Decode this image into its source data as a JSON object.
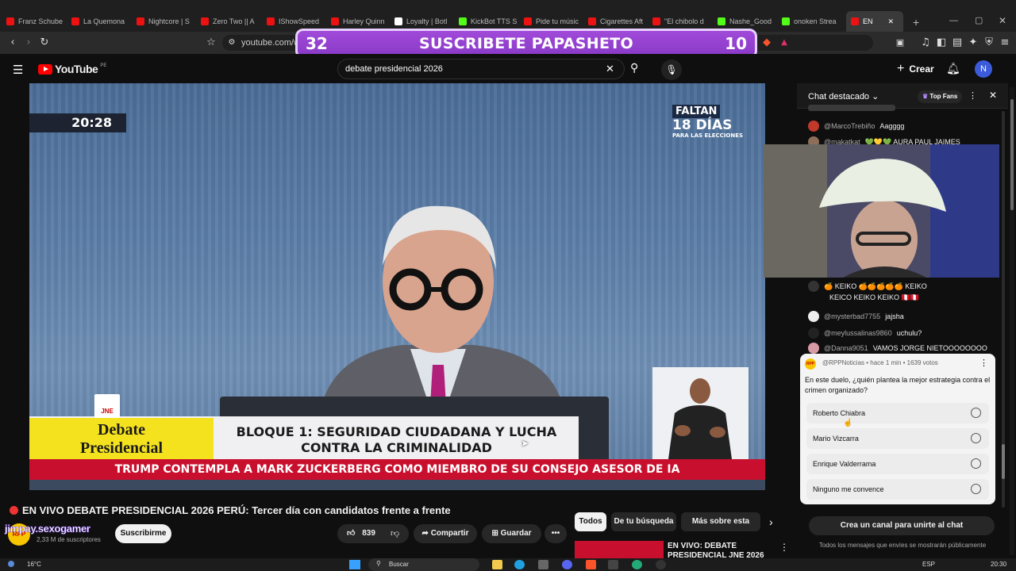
{
  "browser": {
    "tabs": [
      {
        "label": "Franz Schube",
        "kind": "yt"
      },
      {
        "label": "La Quemona",
        "kind": "yt"
      },
      {
        "label": "Nightcore | S",
        "kind": "yt"
      },
      {
        "label": "Zero Two || A",
        "kind": "yt"
      },
      {
        "label": "IShowSpeed",
        "kind": "yt"
      },
      {
        "label": "Harley Quinn",
        "kind": "yt"
      },
      {
        "label": "Loyalty | Botl",
        "kind": "other"
      },
      {
        "label": "KickBot TTS S",
        "kind": "k"
      },
      {
        "label": "Pide tu músic",
        "kind": "yt"
      },
      {
        "label": "Cigarettes Aft",
        "kind": "yt"
      },
      {
        "label": "\"El chibolo d",
        "kind": "yt"
      },
      {
        "label": "Nashe_Good",
        "kind": "k"
      },
      {
        "label": "onoken Strea",
        "kind": "k"
      },
      {
        "label": "EN",
        "kind": "yt",
        "active": true
      }
    ],
    "url": "youtube.com/w"
  },
  "banner": {
    "left_number": "32",
    "text": "SUSCRIBETE PAPASHETO",
    "right_number": "10"
  },
  "youtube": {
    "logo": "YouTube",
    "region": "PE",
    "search_value": "debate presidencial 2026",
    "create_label": "Crear",
    "avatar_letter": "N"
  },
  "video": {
    "time_overlay": "20:28",
    "faltan_line1": "FALTAN",
    "faltan_line2": "18 DÍAS",
    "faltan_line3": "PARA LAS ELECCIONES",
    "jne_label": "JNE",
    "debate_label_line1": "Debate",
    "debate_label_line2": "Presidencial",
    "bloque_line1": "BLOQUE 1: SEGURIDAD CIUDADANA Y LUCHA",
    "bloque_line2": "CONTRA LA CRIMINALIDAD",
    "ticker": "TRUMP CONTEMPLA A MARK ZUCKERBERG COMO MIEMBRO DE SU CONSEJO ASESOR DE IA"
  },
  "below_video": {
    "title": "EN VIVO DEBATE PRESIDENCIAL 2026 PERÚ: Tercer día con candidatos frente a frente",
    "channel_overlay": "jimpay.sexogamer",
    "channel_logo": "RPP",
    "subscribers": "2,33 M de suscriptores",
    "subscribe_label": "Suscribirme",
    "likes": "839",
    "share_label": "Compartir",
    "save_label": "Guardar"
  },
  "filters": [
    "Todos",
    "De tu búsqueda",
    "Más sobre esta histor"
  ],
  "related_video_title": "EN VIVO: DEBATE PRESIDENCIAL JNE 2026",
  "chat": {
    "header_label": "Chat destacado",
    "top_fans_label": "Top Fans",
    "messages": [
      {
        "author": "@MarcoTrebiño",
        "text": "Aagggg",
        "color": "#c0392b"
      },
      {
        "author": "@makatkat",
        "text": "💚💛💚 AURA PAUL JAIMES",
        "color": "#8e6e5a"
      },
      {
        "author": "",
        "text": "🍊 KEIKO 🍊🍊🍊🍊🍊 KEIKO",
        "color": "#333333"
      },
      {
        "author": "",
        "text": "KEICO KEIKO KEIKO 🇵🇪🇵🇪",
        "color": "#333333"
      },
      {
        "author": "@mysterbad7755",
        "text": "jajsha",
        "color": "#eeeeee"
      },
      {
        "author": "@meylussalinas9860",
        "text": "uchulu?",
        "color": "#222222"
      },
      {
        "author": "@Danna9051",
        "text": "VAMOS JORGE NIETOOOOOOOO",
        "color": "#d89aa5"
      }
    ],
    "poll": {
      "meta": "@RPPNoticias • hace 1 min • 1639 votos",
      "question": "En este duelo, ¿quién plantea la mejor estrategia contra el crimen organizado?",
      "options": [
        "Roberto Chiabra",
        "Mario Vizcarra",
        "Enrique Valderrama",
        "Ninguno me convence"
      ]
    },
    "create_channel_label": "Crea un canal para unirte al chat",
    "footer_note": "Todos los mensajes que envíes se mostrarán públicamente"
  },
  "taskbar": {
    "weather": "16°C",
    "search_placeholder": "Buscar",
    "language": "ESP",
    "time": "20:30"
  }
}
